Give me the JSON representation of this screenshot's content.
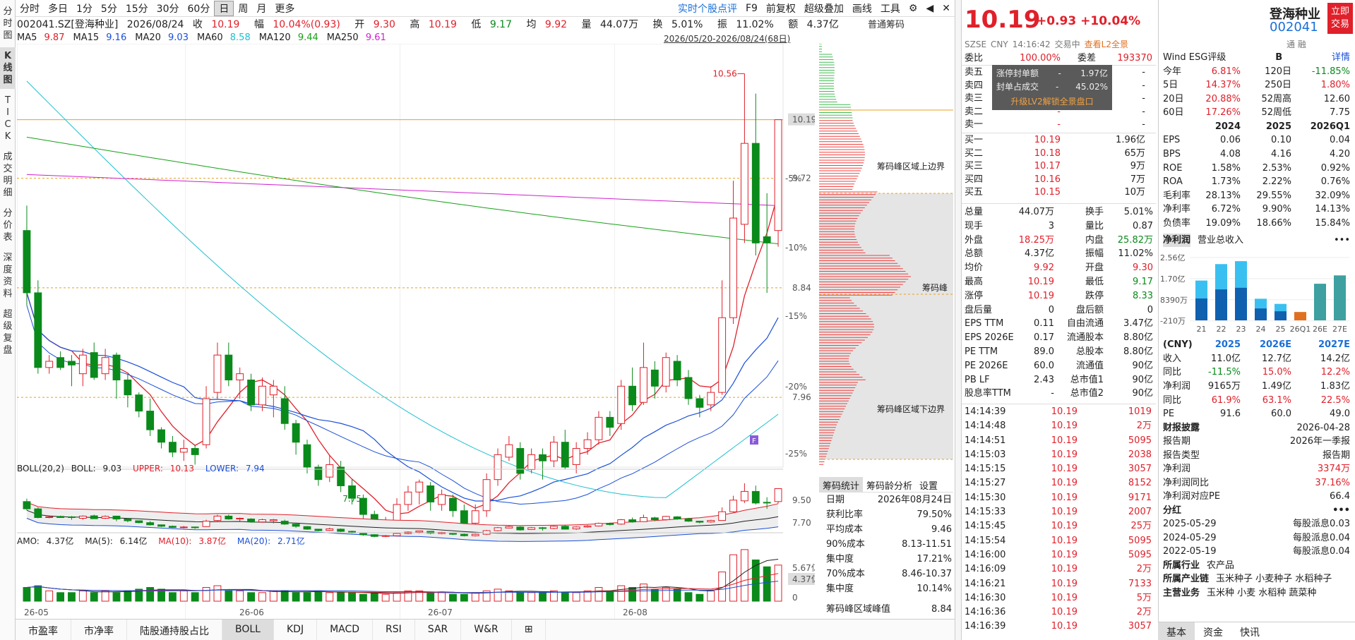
{
  "left_tabs": [
    "分时图",
    "K线图",
    "TICK",
    "成交明细",
    "分价表",
    "深度资料",
    "超级复盘"
  ],
  "toolbar": {
    "items": [
      "分时",
      "多日",
      "1分",
      "5分",
      "15分",
      "30分",
      "60分",
      "日",
      "周",
      "月",
      "更多"
    ],
    "selected": "日",
    "right_items": [
      "实时个股点评",
      "F9",
      "前复权",
      "超级叠加",
      "画线",
      "工具"
    ]
  },
  "quote_bar": {
    "code": "002041.SZ[登海种业]",
    "date": "2026/08/24",
    "close_label": "收",
    "close": "10.19",
    "range_label": "幅",
    "range": "10.04%(0.93)",
    "open_label": "开",
    "open": "9.30",
    "high_label": "高",
    "high": "10.19",
    "low_label": "低",
    "low": "9.17",
    "avg_label": "均",
    "avg": "9.92",
    "vol_label": "量",
    "vol": "44.07万",
    "turn_label": "换",
    "turn": "5.01%",
    "amp_label": "振",
    "amp": "11.02%",
    "amt_label": "额",
    "amt": "4.37亿"
  },
  "ma_bar": [
    {
      "name": "MA5",
      "value": "9.87",
      "color": "#e0202a"
    },
    {
      "name": "MA15",
      "value": "9.16",
      "color": "#1a4fd8"
    },
    {
      "name": "MA20",
      "value": "9.03",
      "color": "#1a4fd8"
    },
    {
      "name": "MA60",
      "value": "8.58",
      "color": "#20c0d0"
    },
    {
      "name": "MA120",
      "value": "9.44",
      "color": "#18a018"
    },
    {
      "name": "MA250",
      "value": "9.61",
      "color": "#d020d0"
    }
  ],
  "date_range": "2026/05/20-2026/08/24(68日)",
  "chart_data": {
    "type": "candlestick",
    "price_axis_labels": [
      "10.19",
      "9.72",
      "8.84",
      "7.96"
    ],
    "percent_axis_labels": [
      "-5%",
      "-10%",
      "-15%",
      "-20%",
      "-25%"
    ],
    "x_labels": [
      "26-05",
      "26-06",
      "26-07",
      "26-08"
    ],
    "ylim": [
      7.4,
      10.8
    ],
    "high_marker": "10.56",
    "low_marker": "7.75",
    "candles": [
      [
        9.3,
        8.8,
        9.5,
        8.7
      ],
      [
        8.8,
        8.2,
        8.9,
        8.15
      ],
      [
        8.2,
        8.25,
        8.3,
        8.15
      ],
      [
        8.28,
        8.2,
        8.33,
        8.18
      ],
      [
        8.25,
        8.22,
        8.3,
        8.05
      ],
      [
        8.15,
        8.3,
        8.35,
        8.05
      ],
      [
        8.32,
        8.12,
        8.4,
        8.1
      ],
      [
        8.15,
        8.28,
        8.35,
        8.1
      ],
      [
        8.3,
        8.1,
        8.32,
        7.95
      ],
      [
        8.1,
        7.98,
        8.15,
        7.88
      ],
      [
        7.98,
        7.85,
        8.0,
        7.8
      ],
      [
        7.85,
        7.7,
        7.95,
        7.65
      ],
      [
        7.7,
        7.6,
        7.72,
        7.55
      ],
      [
        7.6,
        7.52,
        7.65,
        7.48
      ],
      [
        7.52,
        7.55,
        7.62,
        7.45
      ],
      [
        7.55,
        7.5,
        7.58,
        7.42
      ],
      [
        7.58,
        7.95,
        8.05,
        7.55
      ],
      [
        8.0,
        8.3,
        8.4,
        7.95
      ],
      [
        8.3,
        8.1,
        8.4,
        8.05
      ],
      [
        8.1,
        8.15,
        8.2,
        7.95
      ],
      [
        8.1,
        7.9,
        8.15,
        7.85
      ],
      [
        7.9,
        8.05,
        8.12,
        7.85
      ],
      [
        7.98,
        8.05,
        8.1,
        7.8
      ],
      [
        7.95,
        7.75,
        8.05,
        7.7
      ],
      [
        7.75,
        7.6,
        7.78,
        7.5
      ],
      [
        7.58,
        7.4,
        7.62,
        7.35
      ],
      [
        7.4,
        7.3,
        7.42,
        7.25
      ],
      [
        7.32,
        7.42,
        7.5,
        7.28
      ],
      [
        7.4,
        7.25,
        7.45,
        7.2
      ],
      [
        7.25,
        7.15,
        7.3,
        7.1
      ],
      [
        7.15,
        7.02,
        7.18,
        6.95
      ],
      [
        7.02,
        6.9,
        7.05,
        6.85
      ],
      [
        6.92,
        6.95,
        7.0,
        6.85
      ],
      [
        6.95,
        7.1,
        7.15,
        6.9
      ],
      [
        7.1,
        7.2,
        7.25,
        7.05
      ],
      [
        7.2,
        7.28,
        7.3,
        7.1
      ],
      [
        7.25,
        7.12,
        7.28,
        7.05
      ],
      [
        7.1,
        7.18,
        7.22,
        7.05
      ],
      [
        7.15,
        7.05,
        7.18,
        7.0
      ],
      [
        7.05,
        6.95,
        7.1,
        6.9
      ],
      [
        6.95,
        7.05,
        7.1,
        6.9
      ],
      [
        7.05,
        7.3,
        7.35,
        7.0
      ],
      [
        7.3,
        7.5,
        7.55,
        7.25
      ],
      [
        7.48,
        7.58,
        7.65,
        7.45
      ],
      [
        7.55,
        7.35,
        7.6,
        7.3
      ],
      [
        7.38,
        7.5,
        7.55,
        7.35
      ],
      [
        7.5,
        7.45,
        7.55,
        7.3
      ],
      [
        7.45,
        7.6,
        7.65,
        7.4
      ],
      [
        7.6,
        7.4,
        7.7,
        7.38
      ],
      [
        7.42,
        7.55,
        7.6,
        7.35
      ],
      [
        7.55,
        7.62,
        7.68,
        7.5
      ],
      [
        7.62,
        7.8,
        7.85,
        7.58
      ],
      [
        7.8,
        7.72,
        7.85,
        7.65
      ],
      [
        7.75,
        8.05,
        8.1,
        7.7
      ],
      [
        8.05,
        7.9,
        8.2,
        7.85
      ],
      [
        7.92,
        8.2,
        8.4,
        7.9
      ],
      [
        8.18,
        8.05,
        8.25,
        7.95
      ],
      [
        8.05,
        8.28,
        8.32,
        8.0
      ],
      [
        8.25,
        8.1,
        8.3,
        8.05
      ],
      [
        8.12,
        7.95,
        8.18,
        7.9
      ],
      [
        7.95,
        7.88,
        7.98,
        7.8
      ],
      [
        7.9,
        8.0,
        8.05,
        7.85
      ],
      [
        8.0,
        8.6,
        8.9,
        7.98
      ],
      [
        8.6,
        9.4,
        9.7,
        8.55
      ],
      [
        9.35,
        10.0,
        10.56,
        9.2
      ],
      [
        10.0,
        9.2,
        10.4,
        9.1
      ],
      [
        9.25,
        9.2,
        9.6,
        8.8
      ],
      [
        9.3,
        10.19,
        10.19,
        9.17
      ]
    ],
    "volumes": [
      8,
      9,
      6,
      5,
      5,
      6,
      5,
      6,
      5,
      6,
      7,
      8,
      7,
      5,
      6,
      5,
      8,
      9,
      6,
      6,
      5,
      5,
      6,
      6,
      5,
      5,
      6,
      5,
      5,
      5,
      4,
      5,
      4,
      5,
      6,
      6,
      5,
      5,
      4,
      4,
      5,
      6,
      7,
      6,
      5,
      5,
      5,
      6,
      5,
      5,
      6,
      8,
      6,
      9,
      8,
      10,
      7,
      8,
      7,
      5,
      4,
      6,
      17,
      27,
      30,
      24,
      20,
      21
    ],
    "volume_labels": [
      "5.67亿",
      "4.37亿",
      "0"
    ],
    "boll_labels": [
      "9.50",
      "7.70"
    ]
  },
  "boll_header": {
    "name": "BOLL(20,2)",
    "boll_label": "BOLL:",
    "boll": "9.03",
    "upper_label": "UPPER:",
    "upper": "10.13",
    "lower_label": "LOWER:",
    "lower": "7.94"
  },
  "amo_header": {
    "amo_label": "AMO:",
    "amo": "4.37亿",
    "ma5_label": "MA(5):",
    "ma5": "6.14亿",
    "ma10_label": "MA(10):",
    "ma10": "3.87亿",
    "ma20_label": "MA(20):",
    "ma20": "2.71亿"
  },
  "bottom_tabs": [
    "市盈率",
    "市净率",
    "陆股通持股占比",
    "BOLL",
    "KDJ",
    "MACD",
    "RSI",
    "SAR",
    "W&R"
  ],
  "bottom_tab_selected": "BOLL",
  "chip": {
    "title": "普通筹码",
    "labels": [
      "筹码峰区域上边界",
      "筹码峰",
      "筹码峰区域下边界"
    ],
    "tabs": [
      "筹码统计",
      "筹码龄分析",
      "设置"
    ],
    "stats": [
      [
        "日期",
        "2026年08月24日"
      ],
      [
        "获利比率",
        "79.50%"
      ],
      [
        "平均成本",
        "9.46"
      ],
      [
        "90%成本",
        "8.13-11.51"
      ],
      [
        "集中度",
        "17.21%"
      ],
      [
        "70%成本",
        "8.46-10.37"
      ],
      [
        "集中度",
        "10.14%"
      ]
    ],
    "peak_label": "筹码峰区域峰值",
    "peak_value": "8.84"
  },
  "quote": {
    "price": "10.19",
    "change": "+0.93",
    "pct": "+10.04%",
    "market": "SZSE",
    "currency": "CNY",
    "time": "14:16:42",
    "status": "交易中",
    "l2_link": "查看L2全景",
    "weibi_label": "委比",
    "weibi": "100.00%",
    "weicha_label": "委差",
    "weicha": "193370",
    "limit_box": {
      "row1_label": "涨停封单额",
      "row1_value": "1.97亿",
      "row2_label": "封单占成交",
      "row2_value": "45.02%",
      "link": "升级LV2解锁全景盘口"
    },
    "asks": [
      [
        "卖五",
        "-",
        "-"
      ],
      [
        "卖四",
        "-",
        "-"
      ],
      [
        "卖三",
        "-",
        "-"
      ],
      [
        "卖二",
        "-",
        "-"
      ],
      [
        "卖一",
        "-",
        "-"
      ]
    ],
    "bids": [
      [
        "买一",
        "10.19",
        "1.96亿"
      ],
      [
        "买二",
        "10.18",
        "65万"
      ],
      [
        "买三",
        "10.17",
        "9万"
      ],
      [
        "买四",
        "10.16",
        "7万"
      ],
      [
        "买五",
        "10.15",
        "10万"
      ]
    ],
    "stats": [
      [
        "总量",
        "44.07万",
        "换手",
        "5.01%"
      ],
      [
        "现手",
        "3",
        "量比",
        "0.87"
      ],
      [
        "外盘",
        "18.25万",
        "内盘",
        "25.82万"
      ],
      [
        "总额",
        "4.37亿",
        "振幅",
        "11.02%"
      ],
      [
        "均价",
        "9.92",
        "开盘",
        "9.30"
      ],
      [
        "最高",
        "10.19",
        "最低",
        "9.17"
      ],
      [
        "涨停",
        "10.19",
        "跌停",
        "8.33"
      ],
      [
        "盘后量",
        "0",
        "盘后额",
        "0"
      ],
      [
        "EPS TTM",
        "0.11",
        "自由流通",
        "3.47亿"
      ],
      [
        "EPS 2026E",
        "0.17",
        "流通股本",
        "8.80亿"
      ],
      [
        "PE TTM",
        "89.0",
        "总股本",
        "8.80亿"
      ],
      [
        "PE 2026E",
        "60.0",
        "流通值",
        "90亿"
      ],
      [
        "PB LF",
        "2.43",
        "总市值1",
        "90亿"
      ],
      [
        "股息率TTM",
        "-",
        "总市值2",
        "90亿"
      ]
    ],
    "ticks": [
      [
        "14:14:39",
        "10.19",
        "1019"
      ],
      [
        "14:14:48",
        "10.19",
        "2万"
      ],
      [
        "14:14:51",
        "10.19",
        "5095"
      ],
      [
        "14:15:03",
        "10.19",
        "2038"
      ],
      [
        "14:15:15",
        "10.19",
        "3057"
      ],
      [
        "14:15:27",
        "10.19",
        "8152"
      ],
      [
        "14:15:30",
        "10.19",
        "9171"
      ],
      [
        "14:15:33",
        "10.19",
        "2007"
      ],
      [
        "14:15:45",
        "10.19",
        "25万"
      ],
      [
        "14:15:54",
        "10.19",
        "5095"
      ],
      [
        "14:16:00",
        "10.19",
        "5095"
      ],
      [
        "14:16:09",
        "10.19",
        "2万"
      ],
      [
        "14:16:21",
        "10.19",
        "7133"
      ],
      [
        "14:16:30",
        "10.19",
        "5万"
      ],
      [
        "14:16:36",
        "10.19",
        "2万"
      ],
      [
        "14:16:39",
        "10.19",
        "3057"
      ]
    ]
  },
  "company": {
    "name": "登海种业",
    "code": "002041",
    "trade_btn": "立即交易",
    "small": "通  融",
    "esg_label": "Wind ESG评级",
    "esg": "B",
    "detail": "详情",
    "perf": [
      [
        "今年",
        "6.81%",
        "120日",
        "-11.85%"
      ],
      [
        "5日",
        "14.37%",
        "250日",
        "1.80%"
      ],
      [
        "20日",
        "20.88%",
        "52周高",
        "12.60"
      ],
      [
        "60日",
        "17.26%",
        "52周低",
        "7.75"
      ]
    ],
    "fin_head": [
      "",
      "2024",
      "2025",
      "2026Q1"
    ],
    "fin": [
      [
        "EPS",
        "0.06",
        "0.10",
        "0.04"
      ],
      [
        "BPS",
        "4.08",
        "4.16",
        "4.20"
      ],
      [
        "ROE",
        "1.58%",
        "2.53%",
        "0.92%"
      ],
      [
        "ROA",
        "1.73%",
        "2.22%",
        "0.76%"
      ],
      [
        "毛利率",
        "28.13%",
        "29.55%",
        "32.09%"
      ],
      [
        "净利率",
        "6.72%",
        "9.90%",
        "14.13%"
      ],
      [
        "负债率",
        "19.09%",
        "18.66%",
        "15.84%"
      ]
    ],
    "bar_tabs": [
      "净利润",
      "营业总收入"
    ],
    "bar_axis": [
      "2.56亿",
      "1.70亿",
      "8390万",
      "-210万"
    ],
    "bar_x": [
      "21",
      "22",
      "23",
      "24",
      "25",
      "26Q1",
      "26E",
      "27E"
    ],
    "bar_values": [
      1.62,
      2.29,
      2.41,
      0.88,
      0.67,
      0.34,
      1.49,
      1.83
    ],
    "fc_head": [
      "(CNY)",
      "2025",
      "2026E",
      "2027E"
    ],
    "fc": [
      [
        "收入",
        "11.0亿",
        "12.7亿",
        "14.2亿"
      ],
      [
        "同比",
        "-11.5%",
        "15.0%",
        "12.2%"
      ],
      [
        "净利润",
        "9165万",
        "1.49亿",
        "1.83亿"
      ],
      [
        "同比",
        "61.9%",
        "63.1%",
        "22.5%"
      ],
      [
        "PE",
        "91.6",
        "60.0",
        "49.0"
      ]
    ],
    "report_title": "财报披露",
    "report_date": "2026-04-28",
    "report": [
      [
        "报告期",
        "2026年一季报"
      ],
      [
        "报告类型",
        "报告期"
      ],
      [
        "净利润",
        "3374万"
      ],
      [
        "净利润同比",
        "37.16%"
      ],
      [
        "净利润对应PE",
        "66.4"
      ]
    ],
    "div_title": "分红",
    "div": [
      [
        "2025-05-29",
        "每股派息0.03"
      ],
      [
        "2024-05-29",
        "每股派息0.04"
      ],
      [
        "2022-05-19",
        "每股派息0.04"
      ]
    ],
    "industry": [
      [
        "所属行业",
        "农产品"
      ],
      [
        "所属产业链",
        "玉米种子  小麦种子  水稻种子"
      ],
      [
        "主营业务",
        "玉米种  小麦  水稻种  蔬菜种"
      ]
    ],
    "bottom_tabs": [
      "基本",
      "资金",
      "快讯"
    ]
  },
  "colors": {
    "up": "#e0202a",
    "down": "#0a8a1a",
    "accent": "#1a6fd8"
  }
}
